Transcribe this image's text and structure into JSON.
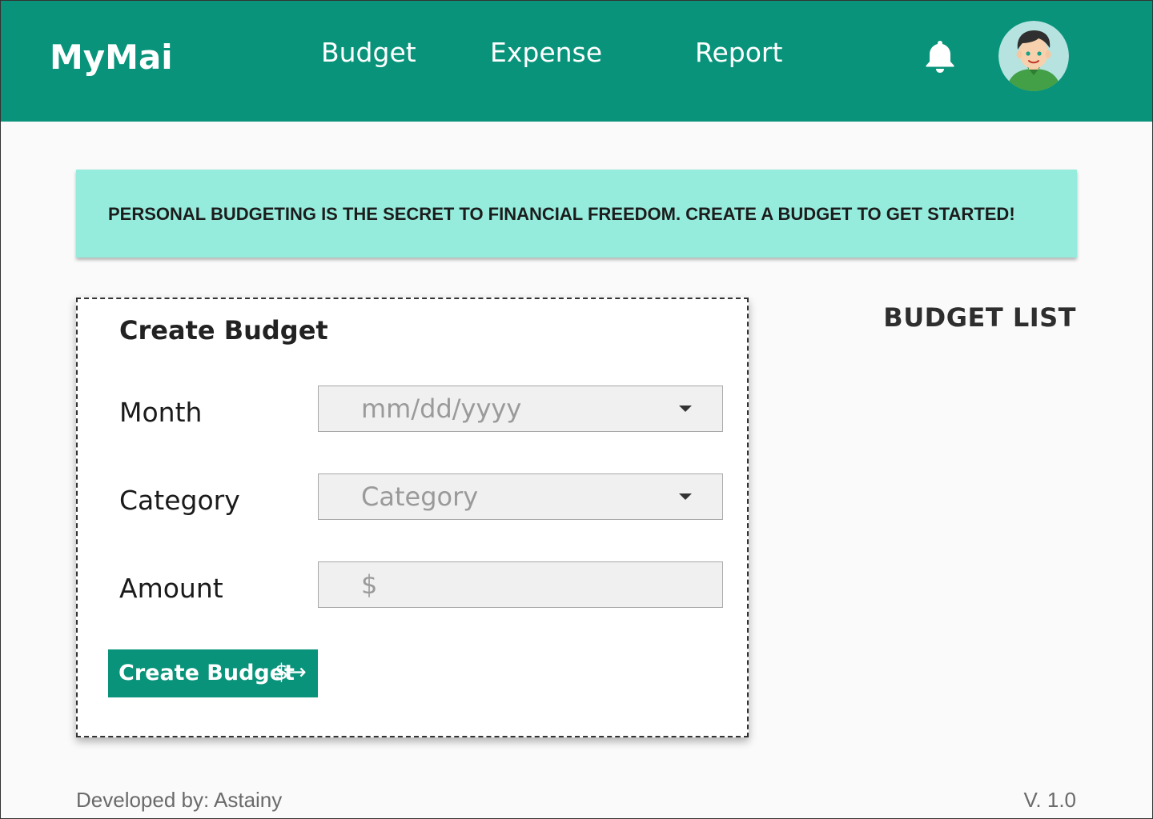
{
  "header": {
    "logo": "MyMai",
    "nav": [
      {
        "label": "Budget"
      },
      {
        "label": "Expense"
      },
      {
        "label": "Report"
      }
    ],
    "notification_icon": "bell-icon",
    "avatar_icon": "user-avatar-icon"
  },
  "banner": {
    "text": "PERSONAL BUDGETING IS THE SECRET TO FINANCIAL FREEDOM. CREATE A BUDGET TO GET STARTED!"
  },
  "form": {
    "title": "Create Budget",
    "month_label": "Month",
    "month_placeholder": "mm/dd/yyyy",
    "category_label": "Category",
    "category_placeholder": "Category",
    "amount_label": "Amount",
    "amount_placeholder": "$",
    "submit_label": "Create Budget",
    "submit_icon": "$→"
  },
  "budget_list": {
    "title": "BUDGET LIST"
  },
  "footer": {
    "developer": "Developed by: Astainy",
    "version": "V. 1.0"
  },
  "colors": {
    "primary": "#08937a",
    "banner": "#95ecdc",
    "background": "#fafafa"
  }
}
